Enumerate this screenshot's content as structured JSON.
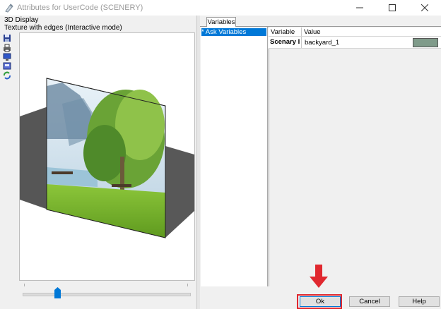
{
  "window": {
    "title": "Attributes for UserCode (SCENERY)",
    "controls": [
      "minimize",
      "maximize",
      "close"
    ]
  },
  "left_panel": {
    "section_label": "3D Display",
    "mode_label": "Texture with edges (Interactive mode)",
    "toolbar_icons": [
      "save-icon",
      "print-icon",
      "monitor-icon",
      "display-settings-icon",
      "refresh-icon"
    ],
    "slider": {
      "position": 0.21
    }
  },
  "right_panel": {
    "tabs": [
      {
        "label": "Variables",
        "selected": true
      }
    ],
    "tree": [
      {
        "label": "* Ask Variables",
        "selected": true
      }
    ],
    "grid": {
      "columns": [
        "Variable",
        "Value"
      ],
      "rows": [
        {
          "variable": "Scenary I",
          "value": "backyard_1",
          "swatch_color": "#7f9b8a"
        }
      ]
    }
  },
  "buttons": {
    "ok": "Ok",
    "cancel": "Cancel",
    "help": "Help"
  },
  "colors": {
    "selection": "#0078d7",
    "highlight_box": "#e0282f",
    "arrow": "#e0282f"
  }
}
